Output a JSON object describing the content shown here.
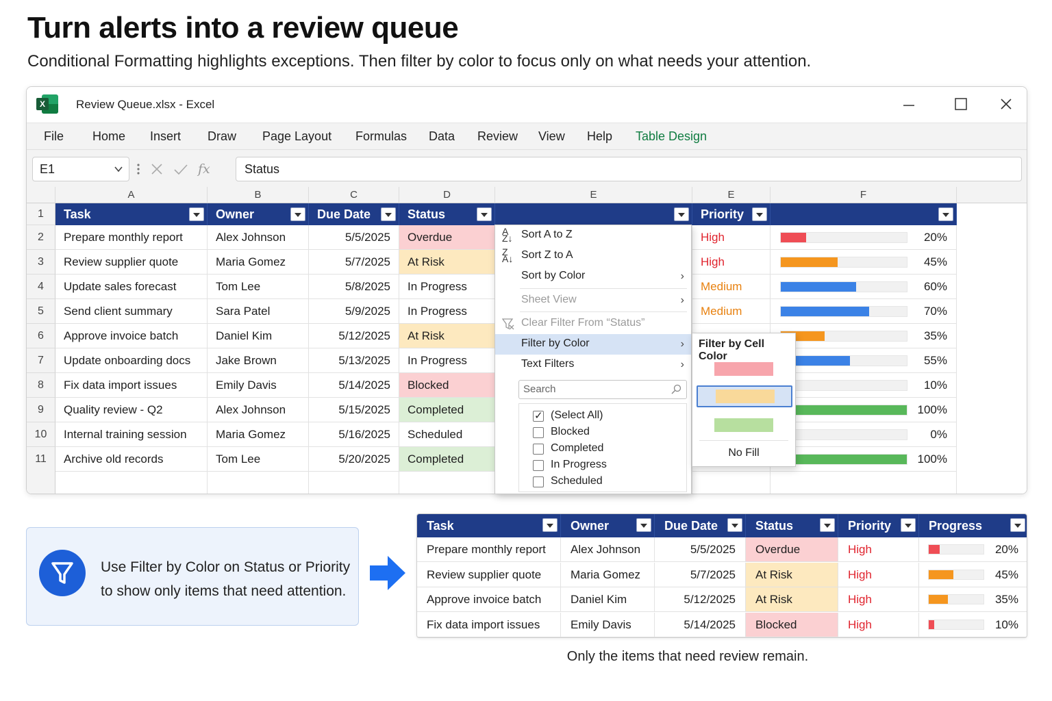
{
  "headline": "Turn alerts into a review queue",
  "subline": "Conditional Formatting highlights exceptions. Then filter by color to focus only on what needs your attention.",
  "window": {
    "title": "Review Queue.xlsx  -  Excel"
  },
  "ribbon": [
    "File",
    "Home",
    "Insert",
    "Draw",
    "Page Layout",
    "Formulas",
    "Data",
    "Review",
    "View",
    "Help",
    "Table Design"
  ],
  "formula_bar": {
    "name_box": "E1",
    "formula": "Status",
    "fx": "fx"
  },
  "columns": [
    "A",
    "B",
    "C",
    "D",
    "E",
    "E",
    "F"
  ],
  "headers": [
    "Task",
    "Owner",
    "Due Date",
    "Status",
    "",
    "Priority",
    ""
  ],
  "rows": [
    {
      "n": "2",
      "task": "Prepare monthly report",
      "owner": "Alex Johnson",
      "due": "5/5/2025",
      "status": "Overdue",
      "prio": "High",
      "pct": "20%",
      "p": 0.2
    },
    {
      "n": "3",
      "task": "Review supplier quote",
      "owner": "Maria Gomez",
      "due": "5/7/2025",
      "status": "At  Risk",
      "prio": "High",
      "pct": "45%",
      "p": 0.45
    },
    {
      "n": "4",
      "task": "Update sales forecast",
      "owner": "Tom Lee",
      "due": "5/8/2025",
      "status": "In Progress",
      "prio": "Medium",
      "pct": "60%",
      "p": 0.6
    },
    {
      "n": "5",
      "task": "Send client summary",
      "owner": "Sara Patel",
      "due": "5/9/2025",
      "status": "In Progress",
      "prio": "Medium",
      "pct": "70%",
      "p": 0.7
    },
    {
      "n": "6",
      "task": "Approve invoice batch",
      "owner": "Daniel Kim",
      "due": "5/12/2025",
      "status": "At  Risk",
      "prio": "",
      "pct": "35%",
      "p": 0.35
    },
    {
      "n": "7",
      "task": "Update onboarding docs",
      "owner": "Jake Brown",
      "due": "5/13/2025",
      "status": "In Progress",
      "prio": "",
      "pct": "55%",
      "p": 0.55
    },
    {
      "n": "8",
      "task": "Fix data import issues",
      "owner": "Emily Davis",
      "due": "5/14/2025",
      "status": "Blocked",
      "prio": "",
      "pct": "10%",
      "p": 0.1
    },
    {
      "n": "9",
      "task": "Quality review - Q2",
      "owner": "Alex Johnson",
      "due": "5/15/2025",
      "status": "Completed",
      "prio": "",
      "pct": "100%",
      "p": 1.0
    },
    {
      "n": "10",
      "task": "Internal training session",
      "owner": "Maria Gomez",
      "due": "5/16/2025",
      "status": "Scheduled",
      "prio": "",
      "pct": "0%",
      "p": 0.0
    },
    {
      "n": "11",
      "task": "Archive old records",
      "owner": "Tom Lee",
      "due": "5/20/2025",
      "status": "Completed",
      "prio": "",
      "pct": "100%",
      "p": 1.0
    }
  ],
  "status_colors": {
    "Overdue": "#fbd0d2",
    "At  Risk": "#fde9bf",
    "Blocked": "#fbd0d2",
    "Completed": "#dcefd6",
    "In Progress": "#ffffff",
    "Scheduled": "#ffffff"
  },
  "bar_colors": {
    "red": "#ef4d55",
    "orange": "#f5961f",
    "blue": "#3b82e6",
    "green": "#58b85a"
  },
  "menu": {
    "sort_az": "Sort A to Z",
    "sort_za": "Sort Z to A",
    "sort_color": "Sort by Color",
    "sheet_view": "Sheet View",
    "clear_filter": "Clear Filter From “Status”",
    "filter_color": "Filter by Color",
    "text_filters": "Text Filters",
    "search_placeholder": "Search",
    "checks": [
      "(Select All)",
      "Blocked",
      "Completed",
      "In Progress",
      "Scheduled"
    ]
  },
  "submenu": {
    "title": "Filter by Cell Color",
    "no_fill": "No Fill",
    "swatches": [
      "#f7a5ac",
      "#f9d99a",
      "#b7df9f"
    ]
  },
  "callout": {
    "line1": "Use Filter by Color on Status or Priority",
    "line2": "to show only items that need attention."
  },
  "result_table": {
    "headers": [
      "Task",
      "Owner",
      "Due Date",
      "Status",
      "Priority",
      "Progress"
    ],
    "rows": [
      {
        "task": "Prepare monthly report",
        "owner": "Alex Johnson",
        "due": "5/5/2025",
        "status": "Overdue",
        "prio": "High",
        "pct": "20%",
        "p": 0.2
      },
      {
        "task": "Review supplier quote",
        "owner": "Maria Gomez",
        "due": "5/7/2025",
        "status": "At Risk",
        "prio": "High",
        "pct": "45%",
        "p": 0.45
      },
      {
        "task": "Approve invoice batch",
        "owner": "Daniel Kim",
        "due": "5/12/2025",
        "status": "At Risk",
        "prio": "High",
        "pct": "35%",
        "p": 0.35
      },
      {
        "task": "Fix data import issues",
        "owner": "Emily Davis",
        "due": "5/14/2025",
        "status": "Blocked",
        "prio": "High",
        "pct": "10%",
        "p": 0.1
      }
    ]
  },
  "caption": "Only the items that need review remain."
}
